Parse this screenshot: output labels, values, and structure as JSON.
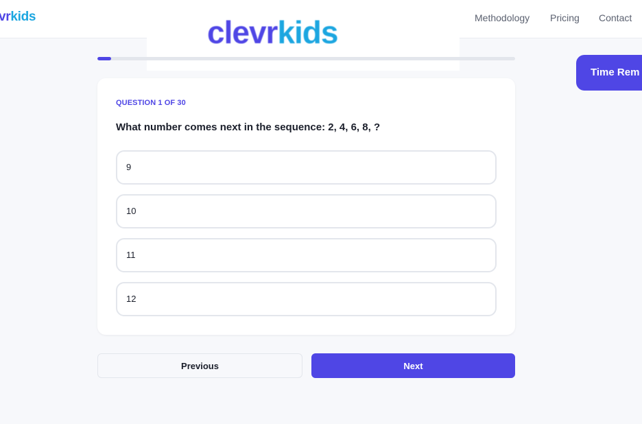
{
  "brand": {
    "name_part1": "clevr",
    "name_part2": "kids",
    "nav_visible_part1": "vr",
    "colors": {
      "primary": "#4f46e5",
      "accent": "#1ca6e0"
    }
  },
  "nav": {
    "links": [
      {
        "label": "Methodology"
      },
      {
        "label": "Pricing"
      },
      {
        "label": "Contact"
      }
    ]
  },
  "timer": {
    "label": "Time Rem"
  },
  "progress": {
    "current": 1,
    "total": 30,
    "fraction": 0.033
  },
  "question": {
    "counter_label": "QUESTION 1 OF 30",
    "text": "What number comes next in the sequence: 2, 4, 6, 8, ?",
    "options": [
      {
        "label": "9"
      },
      {
        "label": "10"
      },
      {
        "label": "11"
      },
      {
        "label": "12"
      }
    ]
  },
  "buttons": {
    "previous": "Previous",
    "next": "Next"
  }
}
